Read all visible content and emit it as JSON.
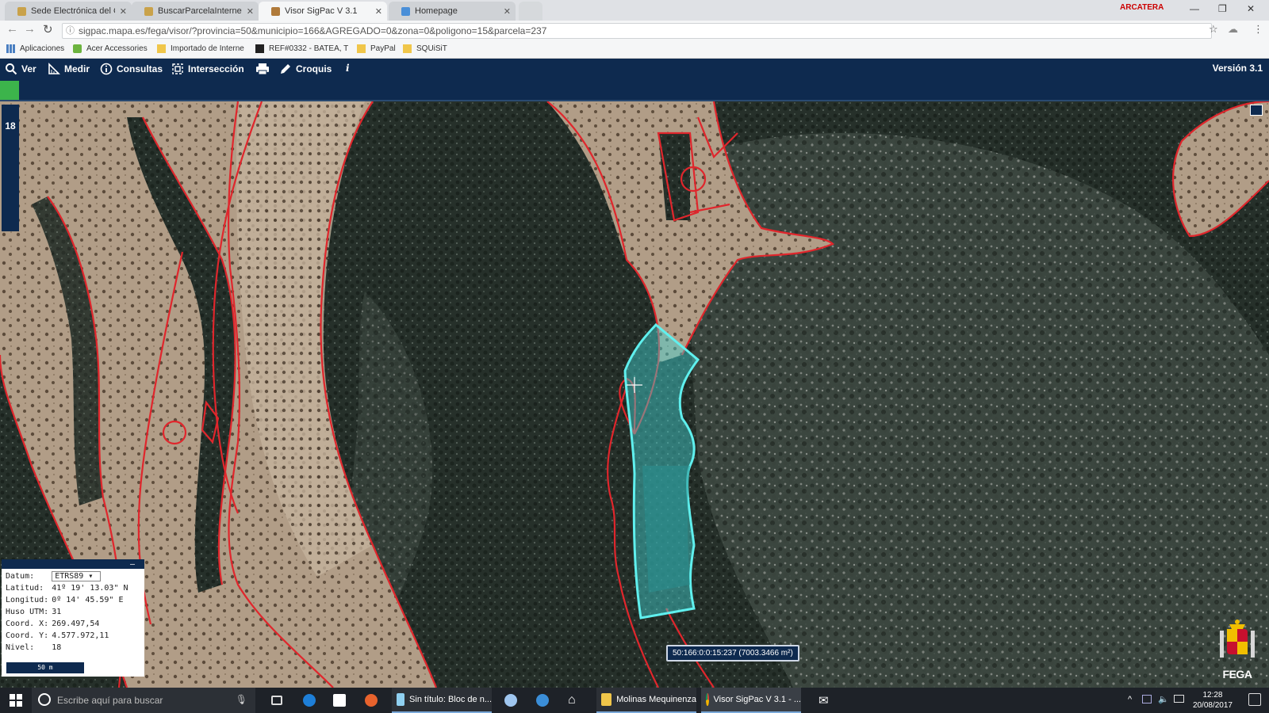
{
  "browser": {
    "tabs": [
      {
        "title": "Sede Electrónica del Cat",
        "active": false
      },
      {
        "title": "BuscarParcelaInternet",
        "active": false
      },
      {
        "title": "Visor SigPac V 3.1",
        "active": true
      },
      {
        "title": "Homepage",
        "active": false
      }
    ],
    "profile_name": "ARCATERA",
    "url": "sigpac.mapa.es/fega/visor/?provincia=50&municipio=166&AGREGADO=0&zona=0&poligono=15&parcela=237",
    "bookmarks": [
      "Aplicaciones",
      "Acer Accessories",
      "Importado de Interne",
      "REF#0332 - BATEA, T",
      "PayPal",
      "SQUiSiT"
    ]
  },
  "toolbar": {
    "items": [
      {
        "label": "Ver",
        "icon": "search-icon"
      },
      {
        "label": "Medir",
        "icon": "ruler-icon"
      },
      {
        "label": "Consultas",
        "icon": "info-icon"
      },
      {
        "label": "Intersección",
        "icon": "intersection-icon"
      },
      {
        "label": "",
        "icon": "print-icon"
      },
      {
        "label": "Croquis",
        "icon": "pencil-icon"
      },
      {
        "label": "i",
        "icon": "italic-info-icon"
      }
    ],
    "version": "Versión 3.1",
    "progress_fraction": 0.015
  },
  "map": {
    "zoom_level": "18",
    "parcel_label": "50:166:0:0:15:237 (7003.3466 m²)",
    "parcel_color": "#43d6d6",
    "boundary_color": "#e0262c"
  },
  "coords_panel": {
    "rows": [
      {
        "label": "Datum:",
        "value": "ETRS89"
      },
      {
        "label": "Latitud:",
        "value": "41º 19' 13.03\" N"
      },
      {
        "label": "Longitud:",
        "value": "0º 14' 45.59\" E"
      },
      {
        "label": "Huso UTM:",
        "value": "31"
      },
      {
        "label": "Coord. X:",
        "value": "269.497,54"
      },
      {
        "label": "Coord. Y:",
        "value": "4.577.972,11"
      },
      {
        "label": "Nivel:",
        "value": "18"
      }
    ],
    "scale": "50 m"
  },
  "logo_text": "FEGA",
  "taskbar": {
    "search_placeholder": "Escribe aquí para buscar",
    "apps": [
      {
        "label": "Sin título: Bloc de n...",
        "icon": "notepad-icon"
      },
      {
        "label": "Molinas Mequinenza",
        "icon": "folder-icon"
      },
      {
        "label": "Visor SigPac V 3.1 - ...",
        "icon": "chrome-icon"
      }
    ],
    "time": "12:28",
    "date": "20/08/2017"
  }
}
